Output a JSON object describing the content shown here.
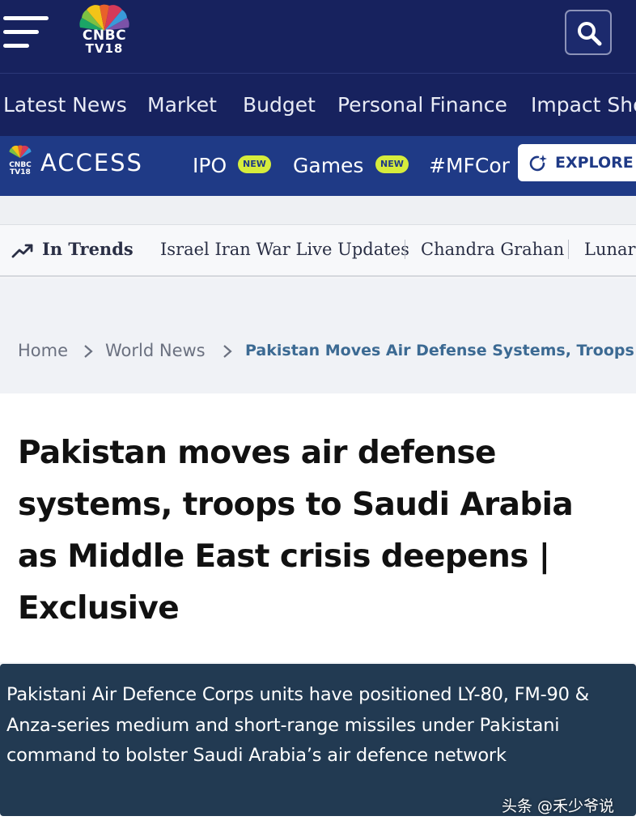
{
  "header": {
    "logo_line1": "CNBC",
    "logo_line2": "TV18",
    "menu_icon": "hamburger-menu-icon",
    "search_icon": "search-icon"
  },
  "nav": {
    "items": [
      "Latest News",
      "Market",
      "Budget",
      "Personal Finance",
      "Impact Sho"
    ]
  },
  "access": {
    "label": "ACCESS",
    "items": [
      {
        "label": "IPO",
        "badge": "NEW"
      },
      {
        "label": "Games",
        "badge": "NEW"
      },
      {
        "label": "#MFCor",
        "badge": ""
      }
    ],
    "explore_label": "EXPLORE"
  },
  "trends": {
    "title": "In Trends",
    "items": [
      "Israel Iran War Live Updates",
      "Chandra Grahan",
      "Lunar"
    ]
  },
  "breadcrumb": {
    "home": "Home",
    "section": "World News",
    "current": "Pakistan Moves Air Defense Systems, Troops T"
  },
  "article": {
    "headline": "Pakistan moves air defense systems, troops to Saudi Arabia as Middle East crisis deepens | Exclusive",
    "summary": "Pakistani Air Defence Corps units have positioned LY-80, FM-90 & Anza-series medium and short-range missiles under Pakistani command to bolster Saudi Arabia’s air defence network"
  },
  "watermark": "头条 @禾少爷说",
  "colors": {
    "header_bg": "#17225e",
    "access_bg": "#1f3a86",
    "badge": "#d6ec3c",
    "summary_bg": "#223a52",
    "breadcrumb_current": "#3c6a93"
  }
}
